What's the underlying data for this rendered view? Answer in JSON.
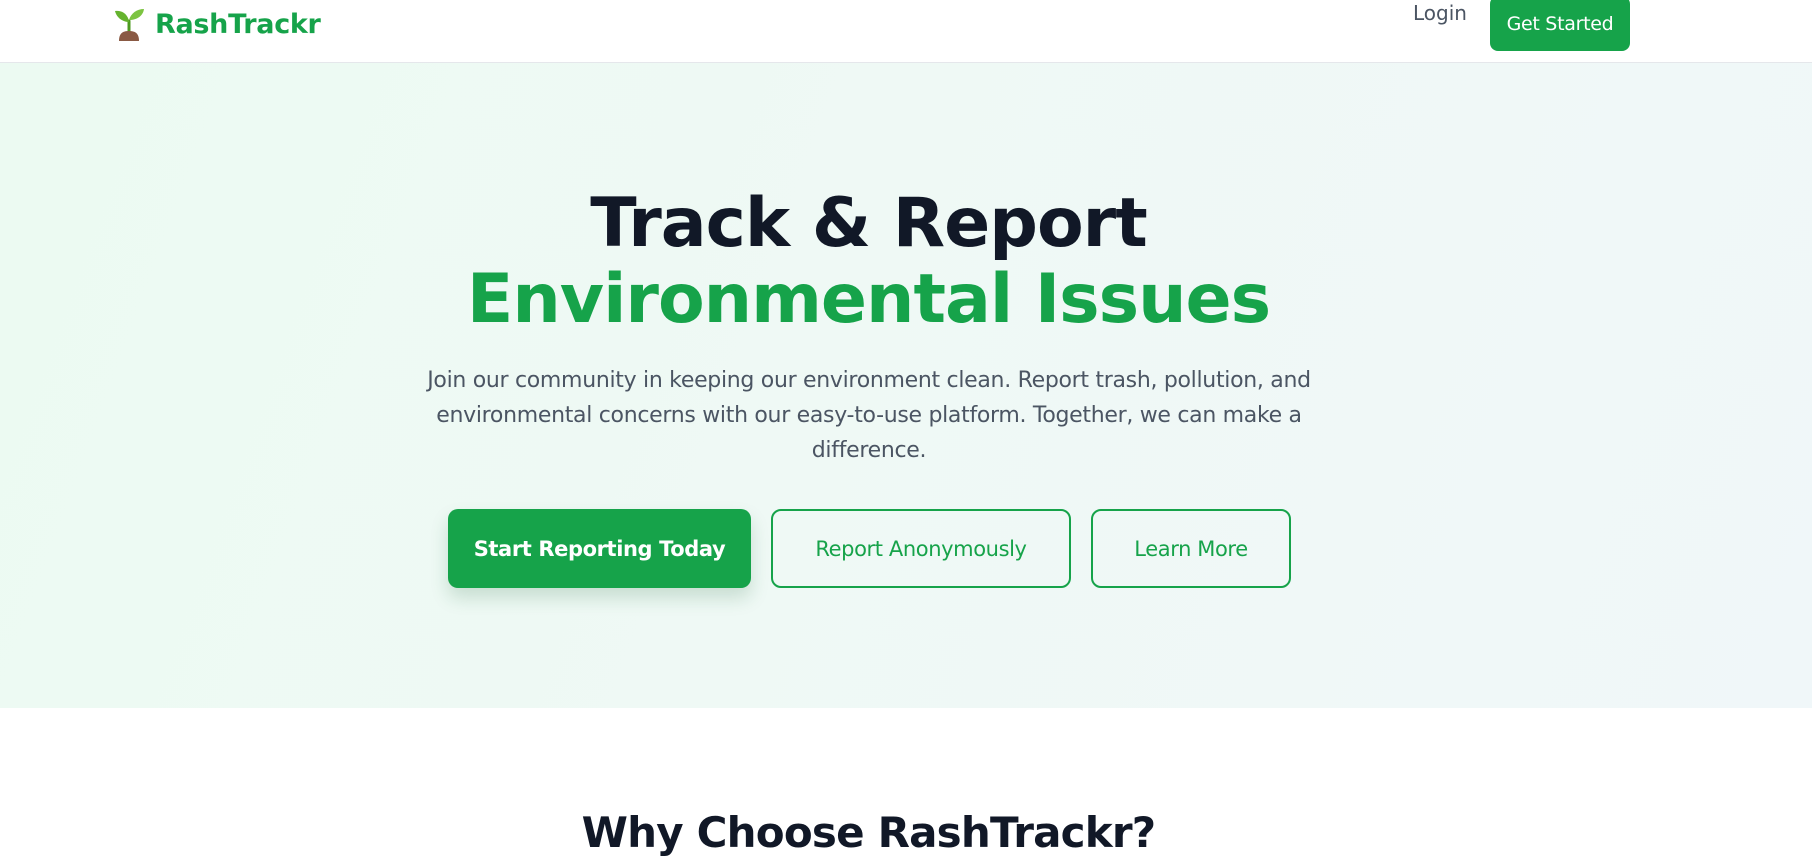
{
  "nav": {
    "brand": "RashTrackr",
    "brand_icon": "seedling-icon",
    "login_label": "Login",
    "get_started_label": "Get Started"
  },
  "hero": {
    "title_line1": "Track & Report",
    "title_line2": "Environmental Issues",
    "subtitle": "Join our community in keeping our environment clean. Report trash, pollution, and environmental concerns with our easy-to-use platform. Together, we can make a difference.",
    "primary_button": "Start Reporting Today",
    "anonymous_button": "Report Anonymously",
    "learn_more_button": "Learn More"
  },
  "features": {
    "heading": "Why Choose RashTrackr?"
  },
  "colors": {
    "brand_green": "#16a34a",
    "heading_dark": "#111827",
    "body_gray": "#4b5563",
    "hero_bg": "#eef9f4"
  }
}
